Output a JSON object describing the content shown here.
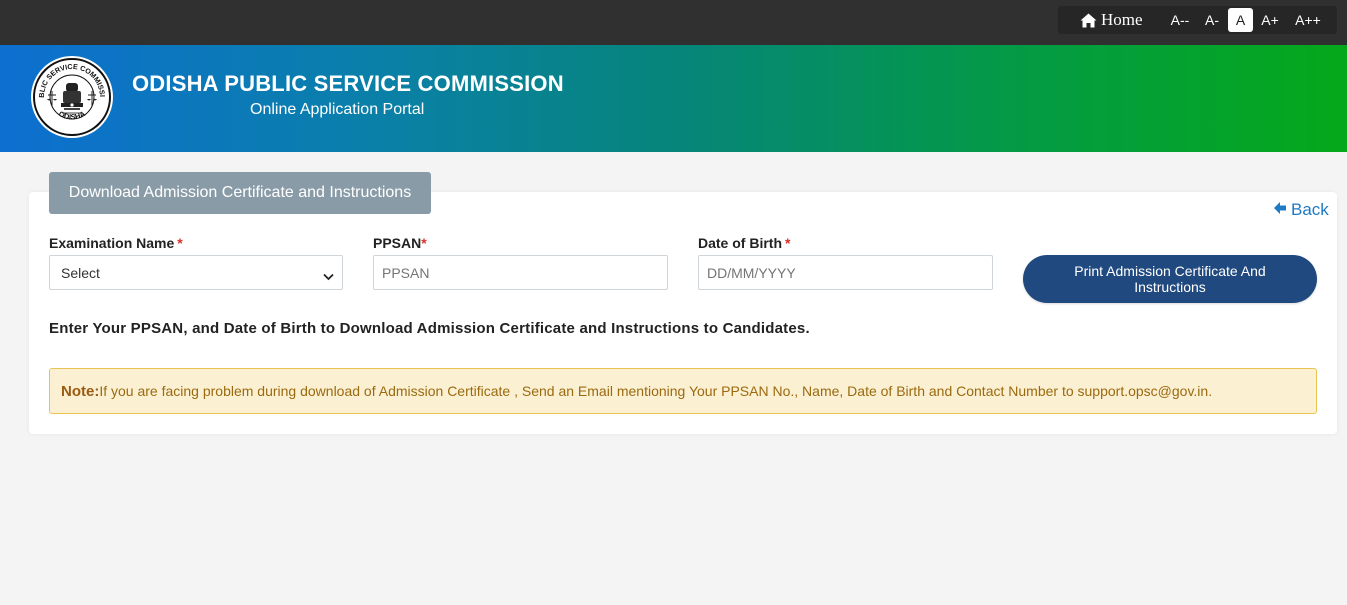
{
  "topbar": {
    "home_label": "Home",
    "font_sizes": [
      "A--",
      "A-",
      "A",
      "A+",
      "A++"
    ],
    "active_font_size": "A"
  },
  "header": {
    "title": "ODISHA PUBLIC SERVICE COMMISSION",
    "subtitle": "Online Application Portal",
    "emblem_text_top": "PUBLIC SERVICE COMMISSION",
    "emblem_text_bottom": "ODISHA"
  },
  "card": {
    "tab_label": "Download Admission Certificate and Instructions",
    "back_label": "Back"
  },
  "form": {
    "exam_name_label": "Examination Name",
    "exam_name_selected": "Select",
    "ppsan_label": "PPSAN",
    "ppsan_placeholder": "PPSAN",
    "dob_label": "Date of Birth",
    "dob_placeholder": "DD/MM/YYYY",
    "required_marker": "*",
    "print_button_label": "Print Admission Certificate And Instructions"
  },
  "instruction_text": "Enter Your PPSAN, and Date of Birth to Download Admission Certificate and Instructions to Candidates.",
  "note": {
    "label": "Note:",
    "text": "If you are facing problem during download of Admission Certificate , Send an Email mentioning Your PPSAN No., Name, Date of Birth and Contact Number to support.opsc@gov.in."
  },
  "colors": {
    "topbar_bg": "#303030",
    "header_gradient_start": "#0d6fd0",
    "header_gradient_end": "#05a81a",
    "tab_bg": "#8a9ba8",
    "print_button_bg": "#20497f",
    "back_link": "#1f7ac4",
    "required_marker": "#d9302c",
    "note_bg": "#fcf0d2",
    "note_border": "#e8c454",
    "note_text": "#9a6a10"
  },
  "icons": {
    "home": "home-icon",
    "back": "arrow-left-icon",
    "select": "chevron-down-icon",
    "emblem": "opsc-emblem-icon"
  }
}
